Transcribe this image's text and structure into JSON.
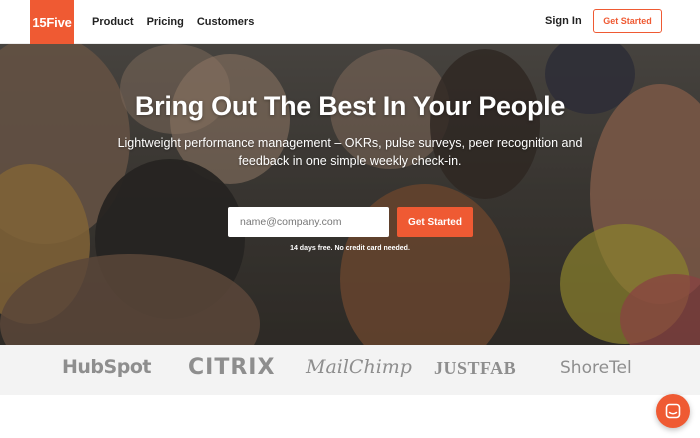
{
  "header": {
    "logo": "15Five",
    "nav": [
      "Product",
      "Pricing",
      "Customers"
    ],
    "sign_in": "Sign In",
    "cta": "Get Started"
  },
  "hero": {
    "title": "Bring Out The Best In Your People",
    "subtitle": "Lightweight performance management – OKRs, pulse surveys, peer recognition and feedback in one simple weekly check-in.",
    "email_placeholder": "name@company.com",
    "cta": "Get Started",
    "note": "14 days free. No credit card needed."
  },
  "logos": [
    "HubSpot",
    "CITRIX",
    "MailChimp",
    "JUSTFAB",
    "ShoreTel"
  ],
  "colors": {
    "accent": "#ef5a33",
    "logo_gray": "#8e8e8e",
    "strip_bg": "#f3f3f3"
  },
  "chat": {
    "icon": "chat-icon"
  }
}
